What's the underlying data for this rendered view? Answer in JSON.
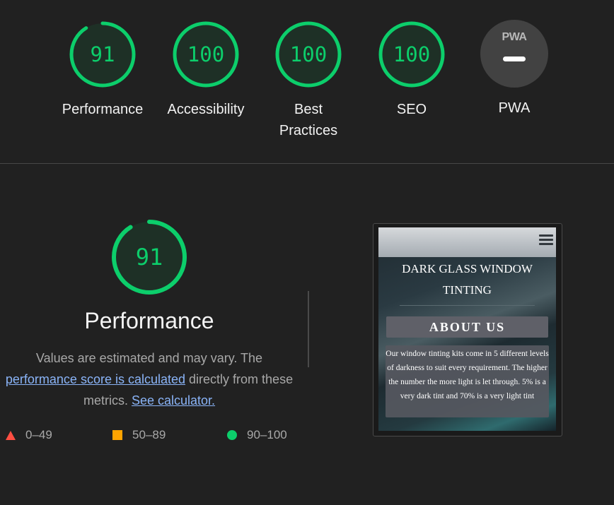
{
  "colors": {
    "pass": "#0cce6b",
    "average": "#ffa400",
    "fail": "#ff4e42"
  },
  "gauges": [
    {
      "label": "Performance",
      "score": "91",
      "value": 91
    },
    {
      "label": "Accessibility",
      "score": "100",
      "value": 100
    },
    {
      "label": "Best Practices",
      "score": "100",
      "value": 100
    },
    {
      "label": "SEO",
      "score": "100",
      "value": 100
    },
    {
      "label": "PWA",
      "badge_text": "PWA",
      "icon": "pwa-dash-icon"
    }
  ],
  "performance": {
    "score": "91",
    "value": 91,
    "title": "Performance",
    "desc_prefix": "Values are estimated and may vary. The",
    "link_score": "performance score is calculated",
    "desc_middle": "directly from these metrics.",
    "link_calculator": "See calculator."
  },
  "legend": [
    {
      "range": "0–49",
      "icon": "triangle-icon"
    },
    {
      "range": "50–89",
      "icon": "square-icon"
    },
    {
      "range": "90–100",
      "icon": "circle-icon"
    }
  ],
  "screenshot": {
    "site_title_line1": "DARK GLASS WINDOW",
    "site_title_line2": "TINTING",
    "button_label": "ABOUT US",
    "body_text": "Our window tinting kits come in 5 different levels of darkness to suit every requirement. The higher the number the more light is let through. 5% is a very dark tint and 70% is a very light tint",
    "menu_icon": "hamburger-menu-icon"
  }
}
